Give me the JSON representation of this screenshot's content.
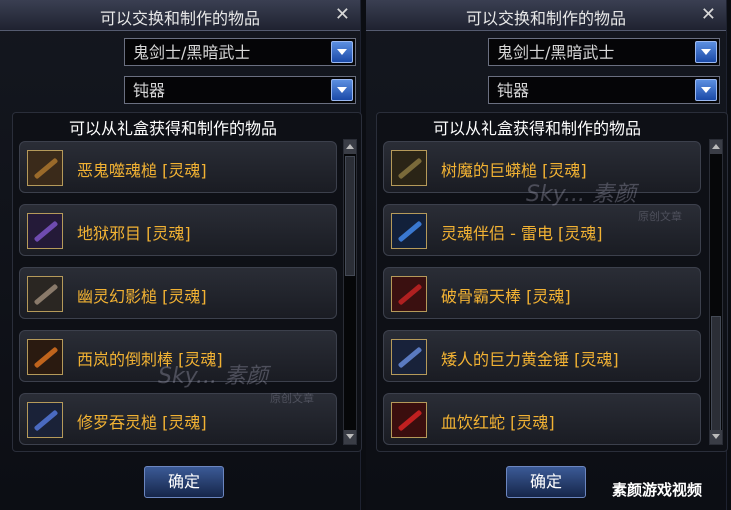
{
  "left_panel": {
    "title": "可以交换和制作的物品",
    "close_glyph": "✕",
    "class_dropdown": "鬼剑士/黑暗武士",
    "weapon_dropdown": "钝器",
    "list_header": "可以从礼盒获得和制作的物品",
    "items": [
      {
        "label": "恶鬼噬魂槌 [灵魂]",
        "icon": "mace-icon",
        "color": "#9a6a2a"
      },
      {
        "label": "地狱邪目 [灵魂]",
        "icon": "staff-icon",
        "color": "#6f4bb0"
      },
      {
        "label": "幽灵幻影槌 [灵魂]",
        "icon": "hammer-icon",
        "color": "#8a7a6a"
      },
      {
        "label": "西岚的倒刺棒 [灵魂]",
        "icon": "club-icon",
        "color": "#c0641c"
      },
      {
        "label": "修罗吞灵槌 [灵魂]",
        "icon": "mace-icon",
        "color": "#4a6ac0"
      }
    ],
    "confirm_label": "确定"
  },
  "right_panel": {
    "title": "可以交换和制作的物品",
    "close_glyph": "✕",
    "class_dropdown": "鬼剑士/黑暗武士",
    "weapon_dropdown": "钝器",
    "list_header": "可以从礼盒获得和制作的物品",
    "items": [
      {
        "label": "树魔的巨蟒槌 [灵魂]",
        "icon": "club-icon",
        "color": "#7a6a3a"
      },
      {
        "label": "灵魂伴侣 - 雷电 [灵魂]",
        "icon": "staff-icon",
        "color": "#3a78d0"
      },
      {
        "label": "破骨霸天棒 [灵魂]",
        "icon": "mace-icon",
        "color": "#b02020"
      },
      {
        "label": "矮人的巨力黄金锤 [灵魂]",
        "icon": "hammer-icon",
        "color": "#5a7ac0"
      },
      {
        "label": "血饮红蛇 [灵魂]",
        "icon": "sword-icon",
        "color": "#c02020"
      }
    ],
    "confirm_label": "确定"
  },
  "watermark": {
    "brand": "Sky... 素颜",
    "sub": "原创文章"
  },
  "footer_caption": "素颜游戏视频"
}
